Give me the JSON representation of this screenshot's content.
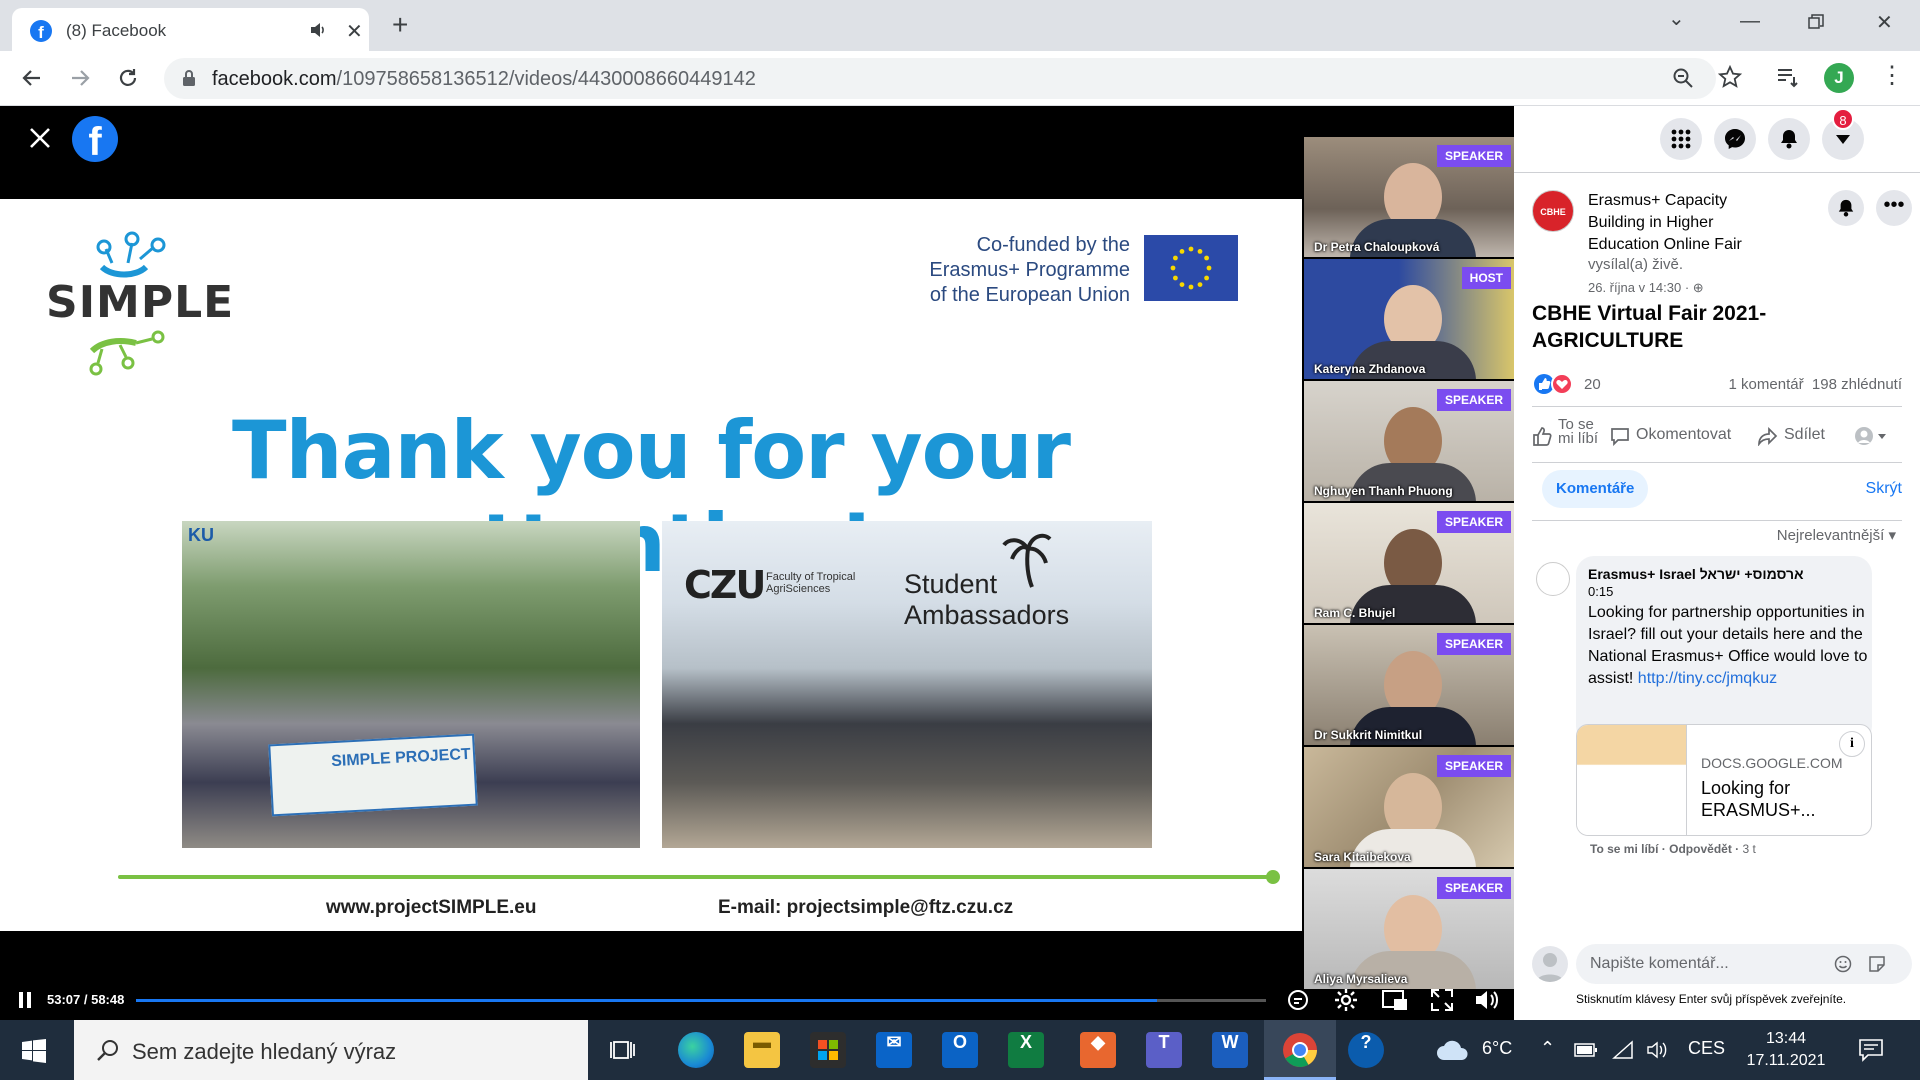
{
  "browser": {
    "tab_title": "(8) Facebook",
    "url_host": "facebook.com",
    "url_path": "/109758658136512/videos/4430008660449142",
    "profile_initial": "J"
  },
  "slide": {
    "logo_text": "SIMPLE",
    "cofunded": "Co-funded by the Erasmus+ Programme of the European Union",
    "headline": "Thank you for your attention!",
    "banner_ku": "KU",
    "banner_text": "SIMPLE PROJECT",
    "czu_logo": "CZU",
    "czu_sub": "Faculty of Tropical AgriSciences",
    "ambassadors": "Student Ambassadors",
    "website": "www.projectSIMPLE.eu",
    "email": "E-mail: projectsimple@ftz.czu.cz"
  },
  "speakers": [
    {
      "badge": "SPEAKER",
      "name": "Dr Petra Chaloupková"
    },
    {
      "badge": "HOST",
      "name": "Kateryna Zhdanova"
    },
    {
      "badge": "SPEAKER",
      "name": "Nghuyen Thanh Phuong"
    },
    {
      "badge": "SPEAKER",
      "name": "Ram C. Bhujel"
    },
    {
      "badge": "SPEAKER",
      "name": "Dr Sukkrit Nimitkul"
    },
    {
      "badge": "SPEAKER",
      "name": "Sara Kitaibekova"
    },
    {
      "badge": "SPEAKER",
      "name": "Aliya Myrsalieva"
    }
  ],
  "player": {
    "time": "53:07 / 58:48",
    "progress": 0.9033
  },
  "panel": {
    "notifications": "8",
    "page_avatar_text": "CBHE",
    "page_name": "Erasmus+ Capacity Building in Higher Education Online Fair",
    "live_text": "vysílal(a) živě.",
    "date": "26. října v 14:30 ·",
    "video_title": "CBHE Virtual Fair 2021- AGRICULTURE",
    "reaction_count": "20",
    "comments_count": "1 komentář",
    "views": "198 zhlédnutí",
    "like_label": "To se mi líbí",
    "comment_label": "Okomentovat",
    "share_label": "Sdílet",
    "comments_tab": "Komentáře",
    "hide_label": "Skrýt",
    "sort_label": "Nejrelevantnější",
    "comment": {
      "author": "Erasmus+ Israel ארסמוס+ ישראל",
      "time": "0:15",
      "text": "Looking for partnership opportunities in Israel? fill out your details here and the National Erasmus+ Office would love to assist!",
      "link": "http://tiny.cc/jmqkuz",
      "card_domain": "DOCS.GOOGLE.COM",
      "card_title": "Looking for ERASMUS+...",
      "like": "To se mi líbí",
      "reply": "Odpovědět",
      "age": "3 t"
    },
    "write_placeholder": "Napište komentář...",
    "enter_hint": "Stisknutím klávesy Enter svůj příspěvek zveřejníte."
  },
  "taskbar": {
    "search_placeholder": "Sem zadejte hledaný výraz",
    "weather": "6°C",
    "language": "CES",
    "time": "13:44",
    "date": "17.11.2021"
  },
  "colors": {
    "facebook_blue": "#1877f2",
    "speaker_badge": "#7b4cf0",
    "slide_headline": "#1c96d6",
    "notification_red": "#e41e3f",
    "taskbar_bg": "#1f2d3d"
  }
}
